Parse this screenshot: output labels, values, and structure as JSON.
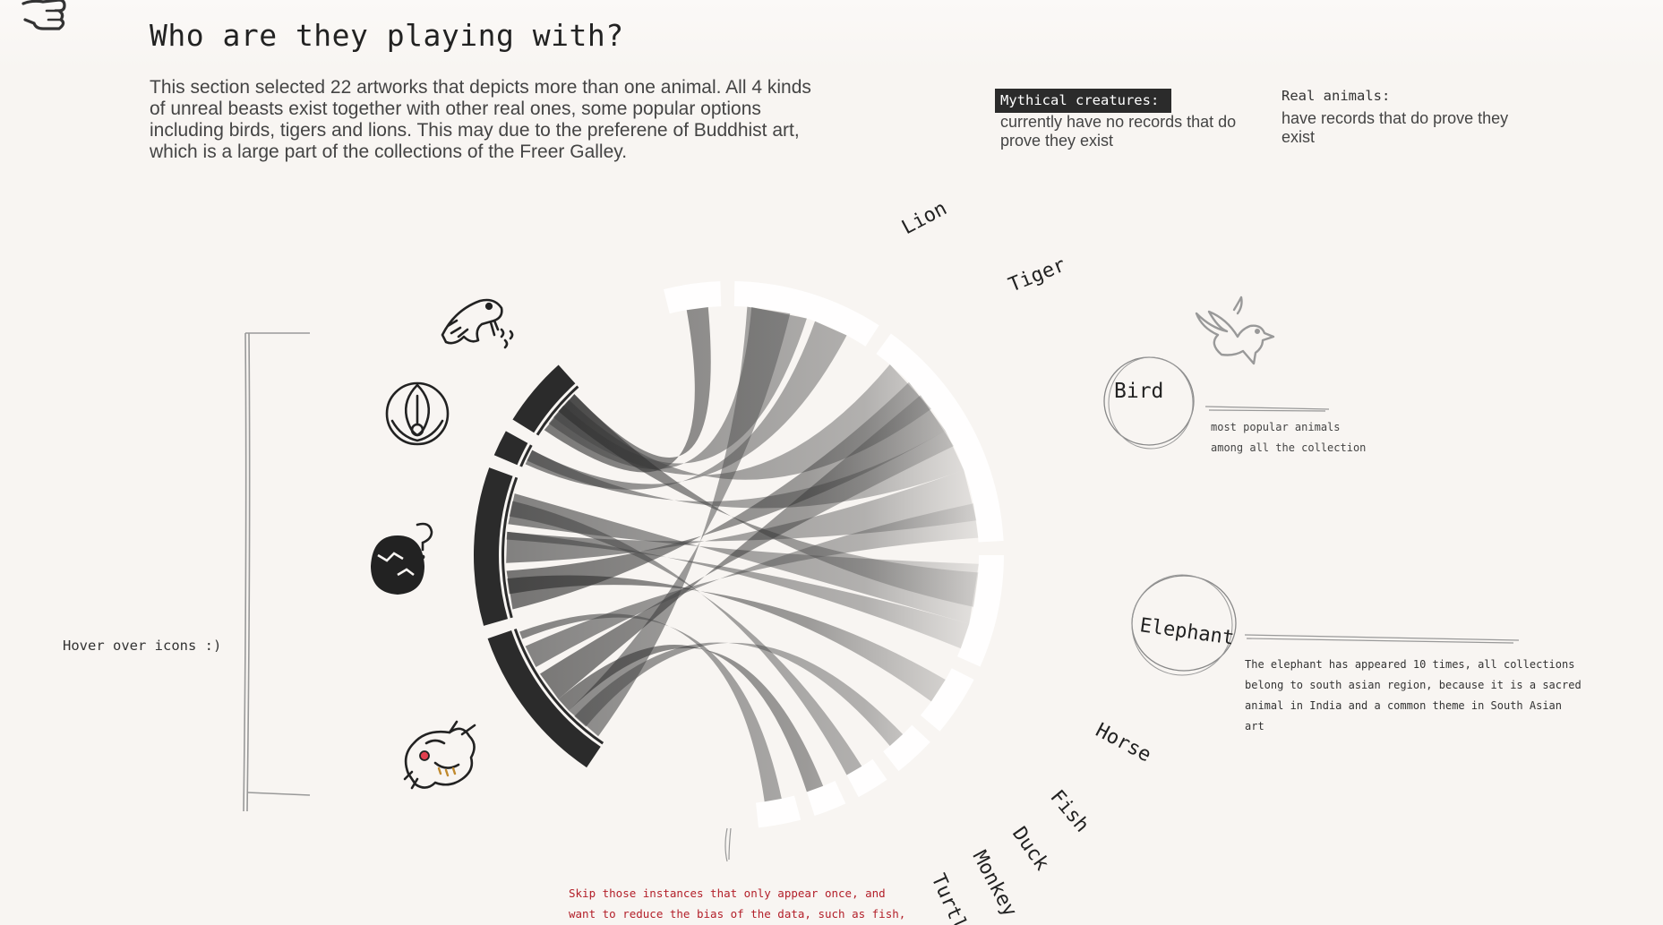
{
  "page": {
    "title": "Who are they playing with?",
    "intro": "This section selected 22 artworks that depicts more than one animal. All 4 kinds of unreal beasts exist together with other real ones, some popular options including birds, tigers and lions. This may due to the preferene of Buddhist art, which is a large part of the collections of the Freer Galley."
  },
  "legend": {
    "mythical_label": "Mythical creatures:",
    "mythical_desc": "currently  have no records that do prove they exist",
    "real_label": "Real  animals:",
    "real_desc": "have records that do prove they exist"
  },
  "hint": "Hover over icons :)",
  "annotations": {
    "bird_circle": "Bird",
    "bird_note_line1": "most popular animals",
    "bird_note_line2": "among all the collection",
    "elephant_circle": "Elephant",
    "elephant_note_line1": "The elephant has appeared 10 times, all collections",
    "elephant_note_line2": "belong to south asian region, because it is a sacred",
    "elephant_note_line3": "animal in India and a common theme in South Asian",
    "elephant_note_line4": "art",
    "red_note_line1": "Skip those instances that only appear once, and",
    "red_note_line2": "want to reduce the bias of the data, such as fish,"
  },
  "animals": {
    "lion": "Lion",
    "tiger": "Tiger",
    "horse": "Horse",
    "fish": "Fish",
    "duck": "Duck",
    "monkey": "Monkey",
    "turtle": "Turtle"
  },
  "icons": {
    "naga": "snake-icon",
    "phoenix": "phoenix-icon",
    "unknown": "mystery-egg-icon",
    "dragon": "dragon-icon",
    "dove": "dove-icon",
    "hand": "pointing-hand-icon"
  },
  "colors": {
    "background": "#f8f5f2",
    "arc_dark": "#2b2b2b",
    "ribbon": "#3a3a3a",
    "red_note": "#b3202a"
  }
}
